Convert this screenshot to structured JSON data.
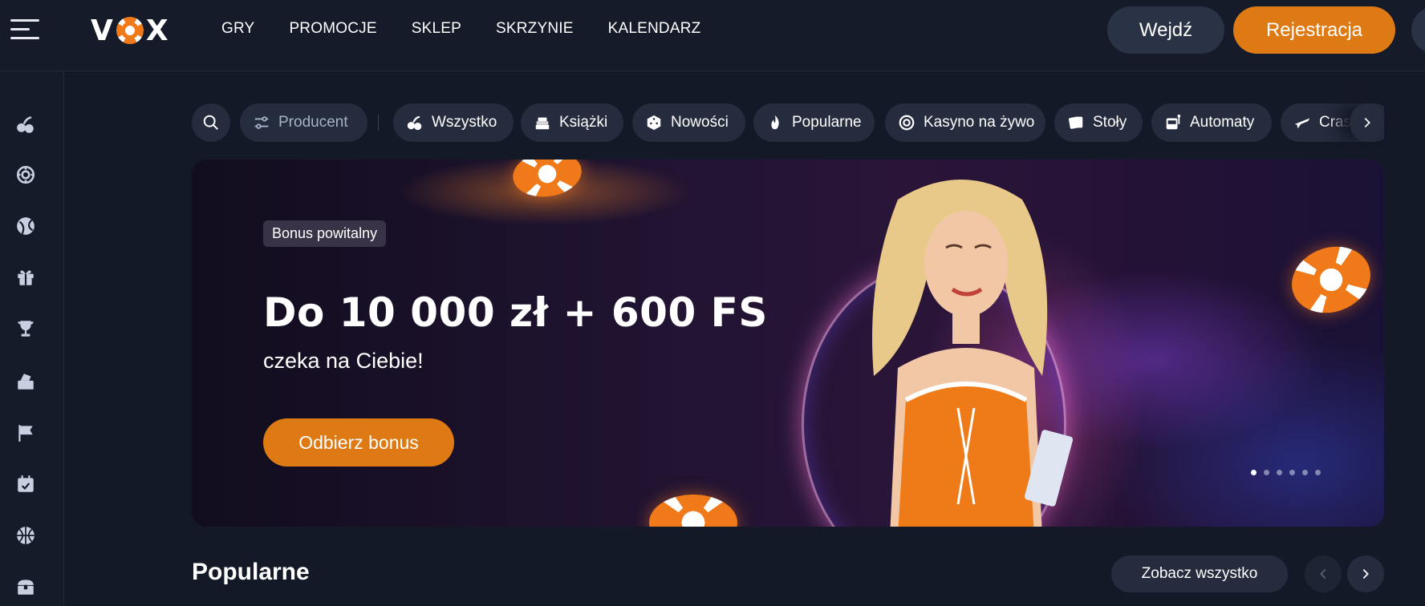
{
  "brand": {
    "logo_left": "V",
    "logo_right": "X"
  },
  "nav": {
    "items": [
      "GRY",
      "PROMOCJE",
      "SKLEP",
      "SKRZYNIE",
      "KALENDARZ"
    ]
  },
  "auth": {
    "login_label": "Wejdź",
    "register_label": "Rejestracja"
  },
  "sidebar": {
    "icons": [
      "cherries-icon",
      "roulette-icon",
      "ball-icon",
      "gift-icon",
      "trophy-icon",
      "cashier-icon",
      "flag-icon",
      "calendar-icon",
      "basketball-icon",
      "chest-icon"
    ]
  },
  "categories": {
    "producer_label": "Producent",
    "items": [
      {
        "label": "Wszystko",
        "icon": "cherries-icon"
      },
      {
        "label": "Książki",
        "icon": "books-icon"
      },
      {
        "label": "Nowości",
        "icon": "dice-icon"
      },
      {
        "label": "Popularne",
        "icon": "fire-icon"
      },
      {
        "label": "Kasyno na żywo",
        "icon": "roulette-icon"
      },
      {
        "label": "Stoły",
        "icon": "cards-icon"
      },
      {
        "label": "Automaty",
        "icon": "slot-icon"
      },
      {
        "label": "Crash",
        "icon": "plane-icon"
      }
    ]
  },
  "banner": {
    "badge": "Bonus powitalny",
    "headline": "Do 10 000 zł + 600 FS",
    "subline": "czeka na Ciebie!",
    "cta": "Odbierz bonus",
    "slides_count": 6,
    "active_slide": 1
  },
  "popular": {
    "title": "Popularne",
    "see_all": "Zobacz wszystko"
  },
  "colors": {
    "accent": "#de7a14",
    "background": "#141928",
    "panel": "#252c3d"
  }
}
